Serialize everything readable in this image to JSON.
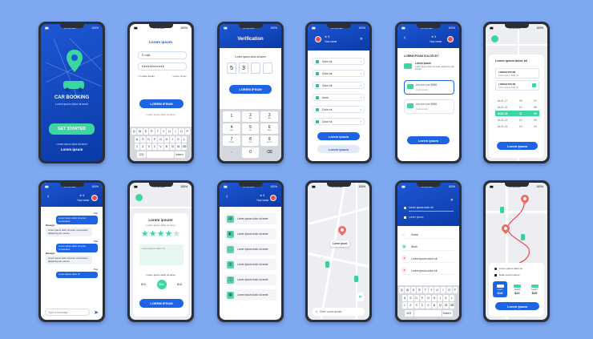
{
  "status": {
    "time": "10:30 AM",
    "battery": "100%"
  },
  "p1": {
    "title": "CAR BOOKING",
    "subtitle": "Lorem ipsum dolor sit amet",
    "cta": "GET STARTED",
    "footer_small": "Lorem ipsum dolor sit amet",
    "footer_big": "Lorem ipsum"
  },
  "p2": {
    "title": "Lorem ipsum",
    "email": "E-mail",
    "password": "●●●●●●●●●●●",
    "remember": "Lorem ipsum",
    "forgot": "Lorem ipsum",
    "button": "LOREM IPSUM",
    "link": "Lorem ipsum dolor sit amet",
    "keys_row1": [
      "Q",
      "W",
      "E",
      "R",
      "T",
      "Y",
      "U",
      "I",
      "O",
      "P"
    ],
    "keys_row2": [
      "A",
      "S",
      "D",
      "F",
      "G",
      "H",
      "J",
      "K",
      "L"
    ],
    "keys_row3": [
      "⇧",
      "Z",
      "X",
      "C",
      "V",
      "B",
      "N",
      "M",
      "⌫"
    ],
    "key_num": "123",
    "key_enter": "Intern"
  },
  "p3": {
    "title": "Verification",
    "caption": "Lorem ipsum dolor sit amet",
    "code": [
      "5",
      "3",
      "",
      ""
    ],
    "button": "LOREM IPSUM",
    "keys": [
      [
        "1",
        "2",
        "3"
      ],
      [
        "4",
        "5",
        "6"
      ],
      [
        "7",
        "8",
        "9"
      ],
      [
        "-",
        "0",
        "⌫"
      ]
    ],
    "keys_sub": [
      "",
      "ABC",
      "DEF",
      "GHI",
      "JKL",
      "MNO",
      "PQRS",
      "TUV",
      "WXYZ",
      "",
      "",
      ""
    ]
  },
  "p4": {
    "rating": "★ 5",
    "name": "Your name",
    "close": "✕",
    "items": [
      "Dolor sit",
      "Dolor sit",
      "Dolor sit",
      "Amet",
      "Dolor sit",
      "Dolor sit"
    ],
    "button": "Lorem ipsum",
    "button2": "Lorem ipsum"
  },
  "p5": {
    "back": "‹",
    "rating": "★ 5",
    "name": "Your name",
    "heading": "LOREM IPSUM DOLOR SIT",
    "wallet_title": "Lorem ipsum",
    "wallet_desc": "Lorem ipsum dolor sit amet, adipiscing elit, sed do",
    "card1": "•••• •••• •••• 0000",
    "card1_sub": "Lorem ipsum",
    "card2": "•••• •••• •••• 0000",
    "card2_sub": "Lorem ipsum",
    "button": "Lorem ipsum"
  },
  "p6": {
    "heading": "Lorem ipsum dolor sit",
    "opt1_title": "LOREM IPSUM",
    "opt1_desc": "Lorem ipsum dolor sit",
    "opt2_title": "LOREM IPSUM",
    "opt2_desc": "Lorem ipsum dolor sit",
    "dates": [
      [
        "AUG 17",
        "09",
        "57"
      ],
      [
        "AUG 16",
        "10",
        "58"
      ],
      [
        "AUG 15",
        "11",
        "59"
      ],
      [
        "AUG 14",
        "12",
        "00"
      ],
      [
        "AUG 13",
        "13",
        "01"
      ]
    ],
    "button": "Lorem ipsum"
  },
  "p7": {
    "back": "‹",
    "rating": "★ 5",
    "name": "Your name",
    "msgs": [
      {
        "who": "You",
        "text": "Lorem ipsum dolor sit amet, consectetur"
      },
      {
        "who": "Manager",
        "text": "Lorem ipsum dolor sit amet, consectetur adipiscing elit, sed do"
      },
      {
        "who": "You",
        "text": "Lorem ipsum dolor sit amet, consectetur"
      },
      {
        "who": "Manager",
        "text": "Lorem ipsum dolor sit amet, consectetur adipiscing elit, sed do"
      },
      {
        "who": "You",
        "text": "Lorem ipsum dolor sit"
      }
    ],
    "input_placeholder": "Type a message ..."
  },
  "p8": {
    "title": "Lorem ipsum!",
    "subtitle": "Lorem ipsum dolor sit amet",
    "stars": [
      "★",
      "★",
      "★",
      "★",
      "★"
    ],
    "textarea": "Lorem ipsum dolor sit",
    "tip_label": "Lorem ipsum dolor sit amet",
    "tips": [
      "$10",
      "$12",
      "$15"
    ],
    "button": "LOREM IPSUM"
  },
  "p9": {
    "back": "‹",
    "rating": "★ 5",
    "name": "Your name",
    "items": [
      "Lorem ipsum dolor sit amet",
      "Lorem ipsum dolor sit amet",
      "Lorem ipsum dolor sit amet",
      "Lorem ipsum dolor sit amet",
      "Lorem ipsum dolor sit amet",
      "Lorem ipsum dolor sit amet"
    ]
  },
  "p10": {
    "pin_label": "Lorem ipsum",
    "search": "Enter Lorem ipsum"
  },
  "p11": {
    "close": "✕",
    "from": "Lorem ipsum dolor sit",
    "to": "Lorem ipsum",
    "list": [
      {
        "icon": "home-icon",
        "label": "Home"
      },
      {
        "icon": "briefcase-icon",
        "label": "Work"
      },
      {
        "icon": "pin-icon",
        "label": "Lorem ipsum dolor sit"
      },
      {
        "icon": "pin-icon",
        "label": "Lorem ipsum dolor sit"
      }
    ]
  },
  "p12": {
    "from": "Lorem ipsum dolor sit",
    "to": "Enter Lorem ipsum",
    "prices": [
      {
        "label": "Lorem",
        "price": "$18"
      },
      {
        "label": "Lorem",
        "price": "$21"
      },
      {
        "label": "Lorem",
        "price": "$25"
      }
    ],
    "button": "Lorem ipsum"
  }
}
